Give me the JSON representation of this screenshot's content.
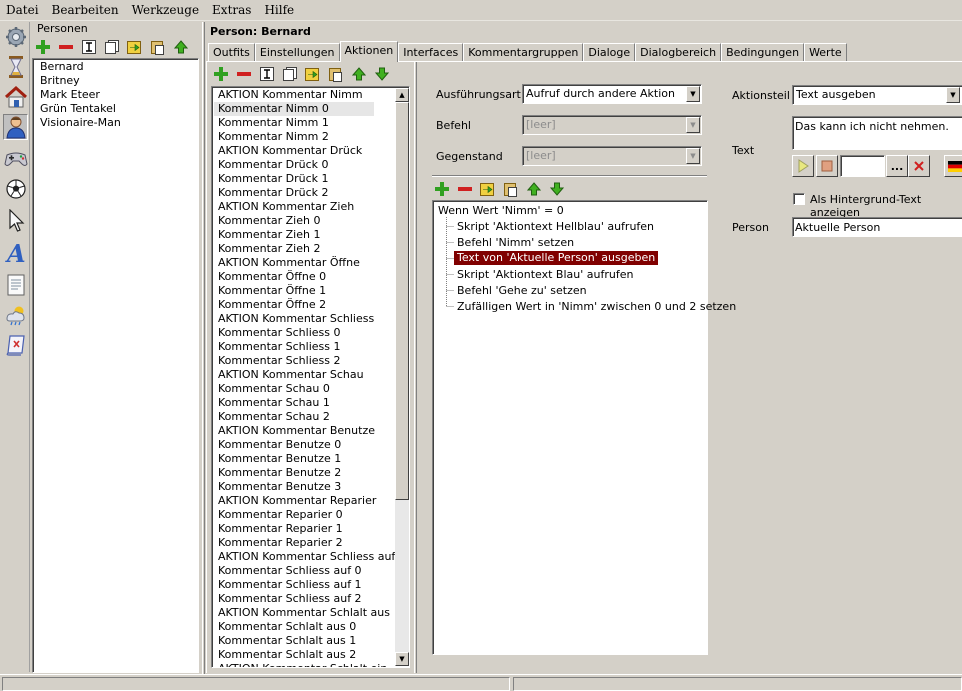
{
  "menu": [
    "Datei",
    "Bearbeiten",
    "Werkzeuge",
    "Extras",
    "Hilfe"
  ],
  "left_toolbar_icons": [
    "gear-icon",
    "hourglass-icon",
    "house-icon",
    "person-icon",
    "gamepad-icon",
    "ball-icon",
    "cursor-icon",
    "font-icon",
    "document-icon",
    "weather-icon",
    "script-icon"
  ],
  "persons": {
    "label": "Personen",
    "items": [
      "Bernard",
      "Britney",
      "Mark Eteer",
      "Grün Tentakel",
      "Visionaire-Man"
    ],
    "selected": 0
  },
  "header": {
    "title": "Person: Bernard"
  },
  "tabs": [
    {
      "label": "Outfits",
      "active": false
    },
    {
      "label": "Einstellungen",
      "active": false
    },
    {
      "label": "Aktionen",
      "active": true
    },
    {
      "label": "Interfaces",
      "active": false
    },
    {
      "label": "Kommentargruppen",
      "active": false
    },
    {
      "label": "Dialoge",
      "active": false
    },
    {
      "label": "Dialogbereich",
      "active": false
    },
    {
      "label": "Bedingungen",
      "active": false
    },
    {
      "label": "Werte",
      "active": false
    }
  ],
  "actions": {
    "items": [
      "AKTION Kommentar Nimm",
      "Kommentar Nimm 0",
      "Kommentar Nimm 1",
      "Kommentar Nimm 2",
      "AKTION Kommentar Drück",
      "Kommentar Drück 0",
      "Kommentar Drück 1",
      "Kommentar Drück 2",
      "AKTION Kommentar Zieh",
      "Kommentar Zieh 0",
      "Kommentar Zieh 1",
      "Kommentar Zieh 2",
      "AKTION Kommentar Öffne",
      "Kommentar Öffne 0",
      "Kommentar Öffne 1",
      "Kommentar Öffne 2",
      "AKTION Kommentar Schliess",
      "Kommentar Schliess 0",
      "Kommentar Schliess 1",
      "Kommentar Schliess 2",
      "AKTION Kommentar Schau",
      "Kommentar Schau 0",
      "Kommentar Schau 1",
      "Kommentar Schau 2",
      "AKTION Kommentar Benutze",
      "Kommentar Benutze 0",
      "Kommentar Benutze 1",
      "Kommentar Benutze 2",
      "Kommentar Benutze 3",
      "AKTION Kommentar Reparier",
      "Kommentar Reparier 0",
      "Kommentar Reparier 1",
      "Kommentar Reparier 2",
      "AKTION Kommentar Schliess auf",
      "Kommentar Schliess auf 0",
      "Kommentar Schliess auf 1",
      "Kommentar Schliess auf 2",
      "AKTION Kommentar Schlalt aus",
      "Kommentar Schlalt aus 0",
      "Kommentar Schlalt aus 1",
      "Kommentar Schlalt aus 2",
      "AKTION Kommentar Schlalt ein"
    ],
    "selected": 1
  },
  "form": {
    "ausfuehrungsart_label": "Ausführungsart",
    "ausfuehrungsart_value": "Aufruf durch andere Aktion",
    "befehl_label": "Befehl",
    "befehl_value": "[leer]",
    "gegenstand_label": "Gegenstand",
    "gegenstand_value": "[leer]"
  },
  "tree": {
    "root": "Wenn Wert 'Nimm' = 0",
    "children": [
      "Skript 'Aktiontext Hellblau' aufrufen",
      "Befehl 'Nimm' setzen",
      "Text von 'Aktuelle Person' ausgeben",
      "Skript 'Aktiontext Blau' aufrufen",
      "Befehl 'Gehe zu' setzen",
      "Zufälligen Wert in 'Nimm' zwischen 0 und 2 setzen"
    ],
    "selected": 2
  },
  "details": {
    "aktionsteil_label": "Aktionsteil",
    "aktionsteil_value": "Text ausgeben",
    "text_label": "Text",
    "text_value": "Das kann ich nicht nehmen.",
    "text_buttons": [
      "play-icon",
      "stop-icon",
      "more-icon",
      "delete-icon",
      "flag-de-icon"
    ],
    "more_label": "...",
    "hintergrund_label": "Als Hintergrund-Text anzeigen",
    "hintergrund_checked": false,
    "person_label": "Person",
    "person_value": "Aktuelle Person"
  },
  "colors": {
    "selection": "#800000",
    "window": "#d4d0c8"
  }
}
